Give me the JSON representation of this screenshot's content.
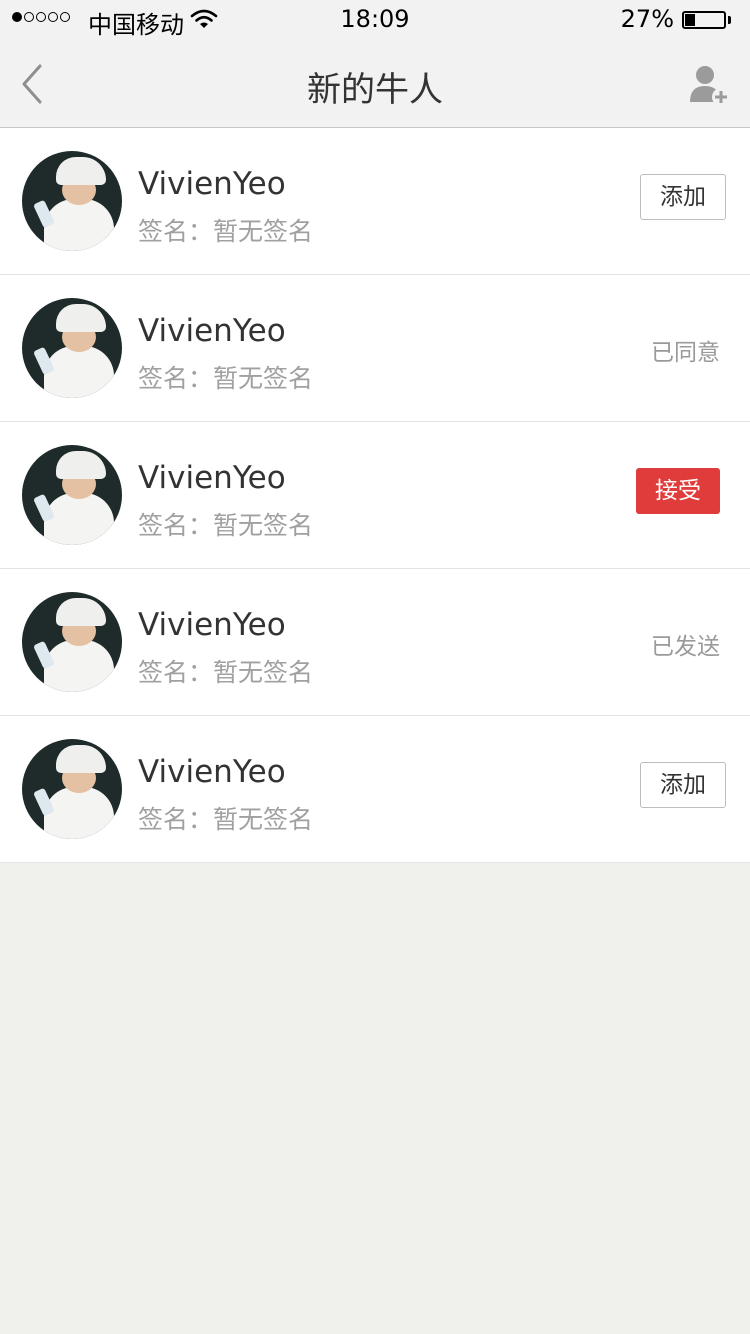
{
  "status_bar": {
    "carrier": "中国移动",
    "time": "18:09",
    "battery_percent": "27%",
    "battery_level": 0.27,
    "signal_strength": 1,
    "signal_max": 5
  },
  "nav": {
    "title": "新的牛人",
    "back_icon": "chevron-left-icon",
    "add_friend_icon": "user-add-icon"
  },
  "colors": {
    "accent_red": "#e03c3c",
    "background": "#f0f0ec"
  },
  "requests": [
    {
      "name": "VivienYeo",
      "signature": "签名：暂无签名",
      "action": "添加",
      "action_type": "button"
    },
    {
      "name": "VivienYeo",
      "signature": "签名：暂无签名",
      "action": "已同意",
      "action_type": "status"
    },
    {
      "name": "VivienYeo",
      "signature": "签名：暂无签名",
      "action": "接受",
      "action_type": "accept"
    },
    {
      "name": "VivienYeo",
      "signature": "签名：暂无签名",
      "action": "已发送",
      "action_type": "status"
    },
    {
      "name": "VivienYeo",
      "signature": "签名：暂无签名",
      "action": "添加",
      "action_type": "button"
    }
  ]
}
